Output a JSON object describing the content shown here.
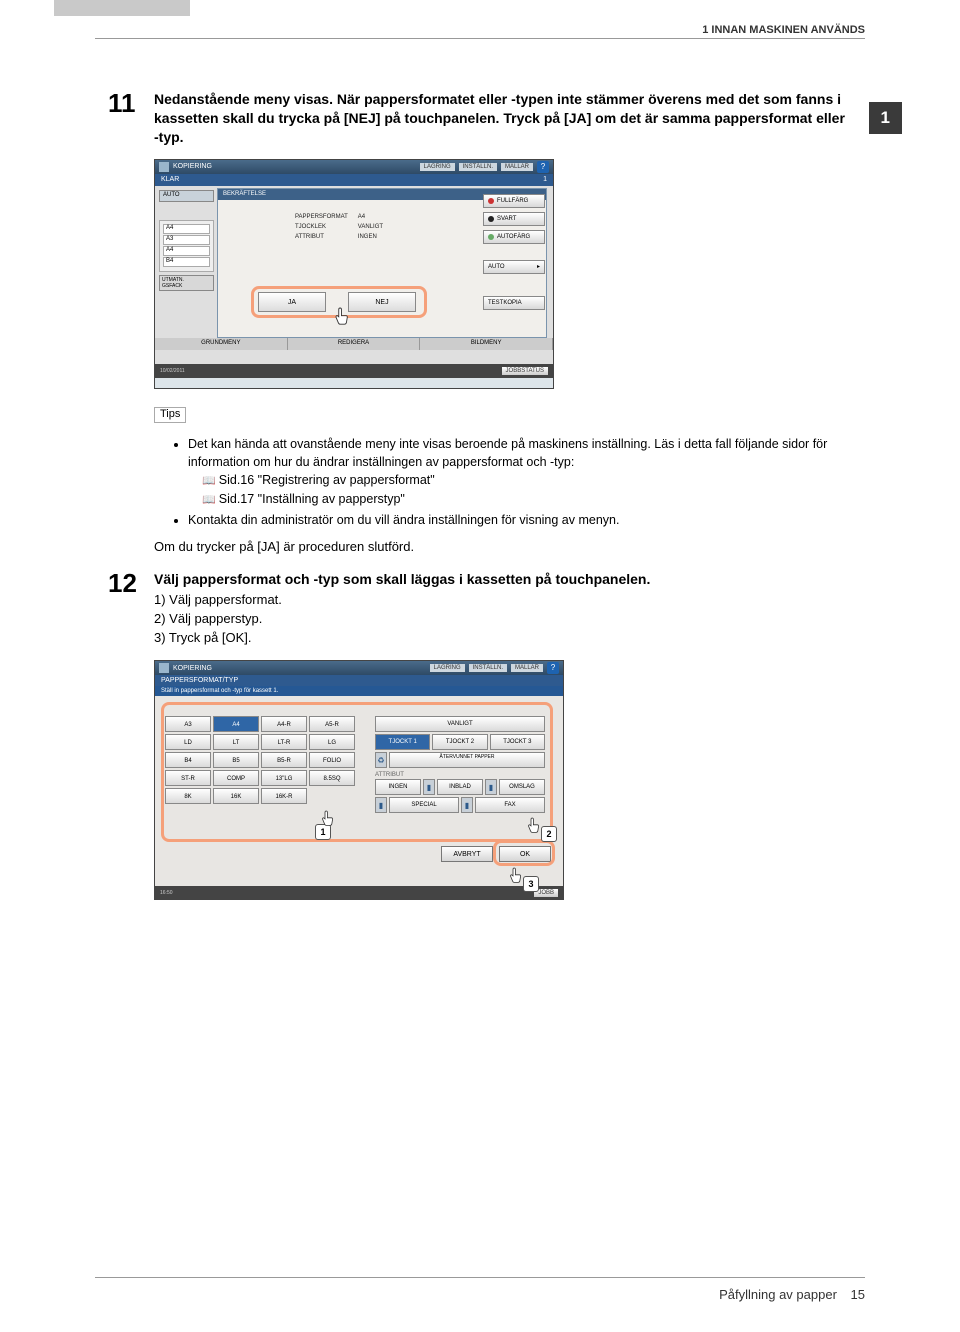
{
  "header": {
    "section_title": "1 INNAN MASKINEN ANVÄNDS",
    "chapter_tab": "1"
  },
  "step11": {
    "number": "11",
    "text": "Nedanstående meny visas. När pappersformatet eller -typen inte stämmer överens med det som fanns i kassetten skall du trycka på [NEJ] på touchpanelen. Tryck på [JA] om det är samma pappersformat eller -typ."
  },
  "screenshot1": {
    "top": {
      "title": "KOPIERING",
      "tab1": "LAGRING",
      "tab2": "INSTÄLLN.",
      "tab3": "MALLAR",
      "help": "?"
    },
    "status": {
      "text": "KLAR",
      "count": "1"
    },
    "left": {
      "auto": "AUTO",
      "trays": [
        "A4",
        "A3",
        "A4",
        "B4"
      ],
      "utmat1": "UTMATN.",
      "utmat2": "GSFACK"
    },
    "modal": {
      "title": "BEKRÄFTELSE",
      "props": [
        [
          "PAPPERSFORMAT",
          "A4"
        ],
        [
          "TJOCKLEK",
          "VANLIGT"
        ],
        [
          "ATTRIBUT",
          "INGEN"
        ]
      ],
      "ja": "JA",
      "nej": "NEJ"
    },
    "right": [
      "FULLFÄRG",
      "SVART",
      "AUTOFÄRG",
      "AUTO",
      "TESTKOPIA"
    ],
    "bottom_tabs": [
      "GRUNDMENY",
      "REDIGERA",
      "BILDMENY"
    ],
    "footer": {
      "date": "10/02/2011",
      "jobstatus": "JOBBSTATUS"
    }
  },
  "tips": {
    "label": "Tips",
    "items": [
      {
        "text": "Det kan hända att ovanstående meny inte visas beroende på maskinens inställning. Läs i detta fall följande sidor för information om hur du ändrar inställningen av pappersformat och -typ:",
        "refs": [
          "Sid.16 \"Registrering av pappersformat\"",
          "Sid.17 \"Inställning av papperstyp\""
        ]
      },
      {
        "text": "Kontakta din administratör om du vill ändra inställningen för visning av menyn."
      }
    ],
    "note": "Om du trycker på [JA] är proceduren slutförd."
  },
  "step12": {
    "number": "12",
    "text": "Välj pappersformat och -typ som skall läggas i kassetten på touchpanelen.",
    "substeps": [
      "1)  Välj pappersformat.",
      "2)  Välj papperstyp.",
      "3)  Tryck på [OK]."
    ]
  },
  "screenshot2": {
    "top": {
      "title": "KOPIERING",
      "tab1": "LAGRING",
      "tab2": "INSTÄLLN.",
      "tab3": "MALLAR",
      "help": "?"
    },
    "banner": "PAPPERSFORMAT/TYP",
    "banner2": "Ställ in pappersformat och -typ för kassett 1.",
    "paper_grid": [
      [
        "A3",
        "A4",
        "A4-R",
        "A5-R"
      ],
      [
        "LD",
        "LT",
        "LT-R",
        "LG"
      ],
      [
        "B4",
        "B5",
        "B5-R",
        "FOLIO"
      ],
      [
        "ST-R",
        "COMP",
        "13\"LG",
        "8.5SQ"
      ],
      [
        "8K",
        "16K",
        "16K-R",
        ""
      ]
    ],
    "selected_paper": "A4",
    "type_row1": [
      "VANLIGT"
    ],
    "type_row2": [
      "TJOCKT 1",
      "TJOCKT 2",
      "TJOCKT 3"
    ],
    "type_row3": [
      "ÅTERVUNNET PAPPER"
    ],
    "attr_label": "ATTRIBUT",
    "type_row4": [
      "INGEN",
      "INBLAD",
      "OMSLAG"
    ],
    "type_row5": [
      "SPECIAL",
      "FAX"
    ],
    "selected_type": "TJOCKT 1",
    "cancel": "AVBRYT",
    "ok": "OK",
    "jobstatus": "JOBB",
    "callouts": [
      "1",
      "2",
      "3"
    ]
  },
  "footer": {
    "text": "Påfyllning av papper",
    "page": "15"
  }
}
